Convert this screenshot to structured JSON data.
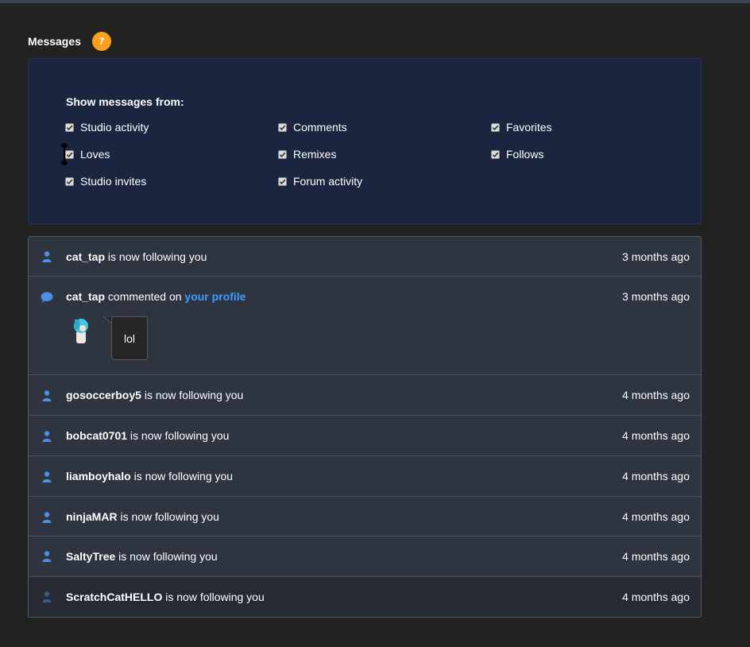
{
  "header": {
    "title": "Messages",
    "badge_count": "7",
    "badge_color": "#f9a11c"
  },
  "filters": {
    "title": "Show messages from:",
    "options": [
      {
        "label": "Studio activity",
        "checked": true
      },
      {
        "label": "Comments",
        "checked": true
      },
      {
        "label": "Favorites",
        "checked": true
      },
      {
        "label": "Loves",
        "checked": true
      },
      {
        "label": "Remixes",
        "checked": true
      },
      {
        "label": "Follows",
        "checked": true
      },
      {
        "label": "Studio invites",
        "checked": true
      },
      {
        "label": "Forum activity",
        "checked": true
      }
    ]
  },
  "messages": [
    {
      "type": "follow",
      "icon": "user-icon",
      "user": "cat_tap",
      "action": " is now following you",
      "time": "3 months ago"
    },
    {
      "type": "comment",
      "icon": "comment-bubble-icon",
      "user": "cat_tap",
      "action": " commented on ",
      "link": "your profile",
      "comment": "lol",
      "time": "3 months ago"
    },
    {
      "type": "follow",
      "icon": "user-icon",
      "user": "gosoccerboy5",
      "action": " is now following you",
      "time": "4 months ago"
    },
    {
      "type": "follow",
      "icon": "user-icon",
      "user": "bobcat0701",
      "action": " is now following you",
      "time": "4 months ago"
    },
    {
      "type": "follow",
      "icon": "user-icon",
      "user": "liamboyhalo",
      "action": " is now following you",
      "time": "4 months ago"
    },
    {
      "type": "follow",
      "icon": "user-icon",
      "user": "ninjaMAR",
      "action": " is now following you",
      "time": "4 months ago"
    },
    {
      "type": "follow",
      "icon": "user-icon",
      "user": "SaltyTree",
      "action": " is now following you",
      "time": "4 months ago"
    },
    {
      "type": "follow",
      "icon": "user-icon",
      "user": "ScratchCatHELLO",
      "action": " is now following you",
      "time": "4 months ago"
    }
  ],
  "colors": {
    "background": "#222222",
    "panel": "#1c2540",
    "link": "#3e9cff",
    "icon": "#4d8fe6"
  }
}
